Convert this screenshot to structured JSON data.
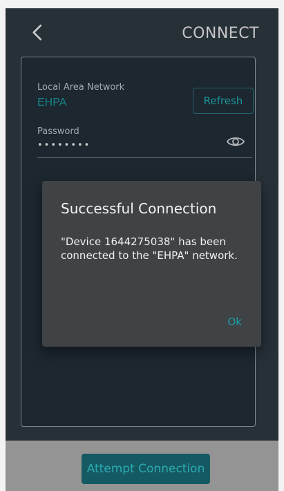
{
  "header": {
    "title": "CONNECT",
    "back_icon": "chevron-left-icon"
  },
  "form": {
    "network_label": "Local Area Network",
    "network_value": "EHPA",
    "refresh_label": "Refresh",
    "password_label": "Password",
    "password_value": "••••••••",
    "password_visibility_icon": "eye-icon"
  },
  "dialog": {
    "title": "Successful Connection",
    "message": "\"Device 1644275038\" has been connected to the \"EHPA\" network.",
    "ok_label": "Ok"
  },
  "footer": {
    "attempt_label": "Attempt Connection"
  },
  "colors": {
    "background": "#2f3b44",
    "card": "#23303a",
    "accent": "#1aa3a8",
    "dialog": "#3f4346",
    "button": "#1a6d78"
  }
}
